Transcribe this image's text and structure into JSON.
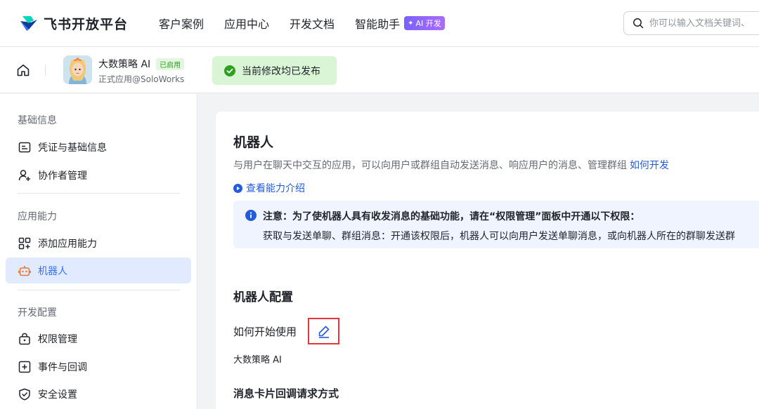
{
  "topnav": {
    "brand": "飞书开放平台",
    "items": [
      {
        "label": "客户案例"
      },
      {
        "label": "应用中心"
      },
      {
        "label": "开发文档"
      },
      {
        "label": "智能助手"
      }
    ],
    "ai_badge": "AI 开发",
    "search_placeholder": "你可以输入文档关键词、"
  },
  "appbar": {
    "app_name": "大数策略 AI",
    "status": "已启用",
    "subtitle": "正式应用@SoloWorks",
    "publish_status": "当前修改均已发布"
  },
  "sidebar": {
    "sections": [
      {
        "title": "基础信息",
        "items": [
          {
            "label": "凭证与基础信息",
            "icon": "credential-icon"
          },
          {
            "label": "协作者管理",
            "icon": "user-add-icon"
          }
        ]
      },
      {
        "title": "应用能力",
        "items": [
          {
            "label": "添加应用能力",
            "icon": "apps-add-icon"
          },
          {
            "label": "机器人",
            "icon": "robot-icon",
            "active": true
          }
        ]
      },
      {
        "title": "开发配置",
        "items": [
          {
            "label": "权限管理",
            "icon": "lock-icon"
          },
          {
            "label": "事件与回调",
            "icon": "event-icon"
          },
          {
            "label": "安全设置",
            "icon": "shield-icon"
          }
        ]
      }
    ]
  },
  "content": {
    "title": "机器人",
    "description": "与用户在聊天中交互的应用，可以向用户或群组自动发送消息、响应用户的消息、管理群组",
    "how_to_link": "如何开发",
    "intro_link": "查看能力介绍",
    "notice_line1": "注意：为了使机器人具有收发消息的基础功能，请在“权限管理”面板中开通以下权限：",
    "notice_line2": "获取与发送单聊、群组消息：开通该权限后，机器人可以向用户发送单聊消息，或向机器人所在的群聊发送群",
    "config_title": "机器人配置",
    "field_label": "如何开始使用",
    "field_value": "大数策略 AI",
    "callback_title": "消息卡片回调请求方式"
  },
  "colors": {
    "accent": "#3370ff",
    "link": "#245bdb",
    "success": "#2ea121",
    "highlight_box": "#e5343b"
  }
}
